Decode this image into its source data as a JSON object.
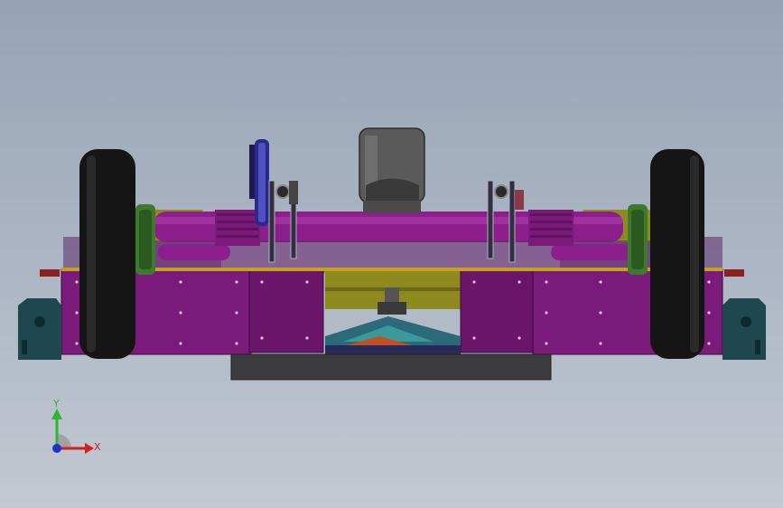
{
  "viewport": {
    "background_top": "#97a3b6",
    "background_bottom": "#c3c9d2"
  },
  "model": {
    "icon": "mower-assembly-3d-model",
    "colors": {
      "deck": "#7a1a7a",
      "deck_dark": "#5c125c",
      "tube": "#8c1f8c",
      "olive": "#8f8a1e",
      "tire": "#151515",
      "motor": "#5a5a5a",
      "pillow_block": "#1f4750",
      "plate": "#3c3c3e",
      "pulley": "#2a2a8a",
      "hub_green": "#3e7a2e"
    }
  },
  "triad": {
    "y_label": "Y",
    "x_label": "X",
    "y_color": "#2fb52f",
    "x_color": "#d22020",
    "z_color": "#2030d0"
  }
}
